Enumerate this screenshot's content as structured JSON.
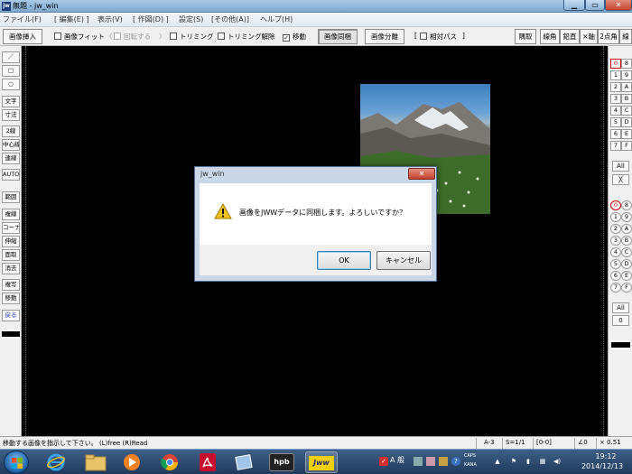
{
  "window": {
    "app_icon": "jw",
    "title": "無題 - jw_win",
    "minimize_icon": "minimize-icon",
    "maximize_icon": "maximize-icon",
    "close_icon": "close-icon"
  },
  "menu": [
    "ファイル(F)",
    "[ 編集(E) ]",
    "表示(V)",
    "[ 作図(D) ]",
    "設定(S)",
    "[その他(A)]",
    "ヘルプ(H)"
  ],
  "toolbar": {
    "insert_image": "画像挿入",
    "fit_image": "画像フィット",
    "rotate_bracket_open": "〈",
    "rotate": "回転する",
    "rotate_bracket_close": "〉",
    "trimming": "トリミング",
    "trimming_cancel": "トリミング解除",
    "move": "移動",
    "image_same": "画像同梱",
    "image_split": "画像分離",
    "relative_path_open": "[",
    "relative_path": "相対パス",
    "relative_path_close": "]",
    "move_checked_mark": "✓",
    "right_buttons": [
      "隅取",
      "線角",
      "鉛直",
      "×軸",
      "2点角",
      "線"
    ]
  },
  "left_tools": [
    "／",
    "□",
    "○",
    "文字",
    "寸法",
    "2線",
    "中心線",
    "連線",
    "AUTO",
    "範囲",
    "複線",
    "コーナー",
    "伸縮",
    "面取",
    "消去",
    "複写",
    "移動",
    "戻る"
  ],
  "right_layers": {
    "group1_left": [
      "0",
      "1",
      "2",
      "3",
      "4",
      "5",
      "6",
      "7"
    ],
    "group1_right": [
      "8",
      "9",
      "A",
      "B",
      "C",
      "D",
      "E",
      "F"
    ],
    "group1_all": "All",
    "group1_cross": "╳",
    "group2_left": [
      "0",
      "1",
      "2",
      "3",
      "4",
      "5",
      "6",
      "7"
    ],
    "group2_right": [
      "8",
      "9",
      "A",
      "B",
      "C",
      "D",
      "E",
      "F"
    ],
    "group2_all": "All",
    "group2_zero": "0"
  },
  "dialog": {
    "title": "jw_win",
    "close_icon": "close-icon",
    "warning_icon": "warning-icon",
    "message": "画像をJWWデータに同梱します。よろしいですか？",
    "ok_label": "OK",
    "cancel_label": "キャンセル"
  },
  "status": {
    "message": "移動する画像を指示して下さい。 (L)free (R)Read",
    "paper": "A-3",
    "scale": "S=1/1",
    "layer": "[0-0]",
    "angle": "∠0",
    "zoom": "× 0.51"
  },
  "taskbar": {
    "start_icon": "windows-start-icon",
    "apps": [
      "ie-icon",
      "explorer-icon",
      "media-player-icon",
      "chrome-icon",
      "acrobat-icon",
      "files-icon",
      "hpb-icon",
      "jww-icon"
    ],
    "app_labels": {
      "hpb": "hpb",
      "jww": "Jww"
    },
    "ime": "A 般",
    "caps_label": "CAPS",
    "kana_label": "KANA",
    "time": "19:12",
    "date": "2014/12/13"
  },
  "colors": {
    "canvas_bg": "#000000",
    "selected_layer": "#d00000",
    "taskbar": "#1f3a5c"
  }
}
